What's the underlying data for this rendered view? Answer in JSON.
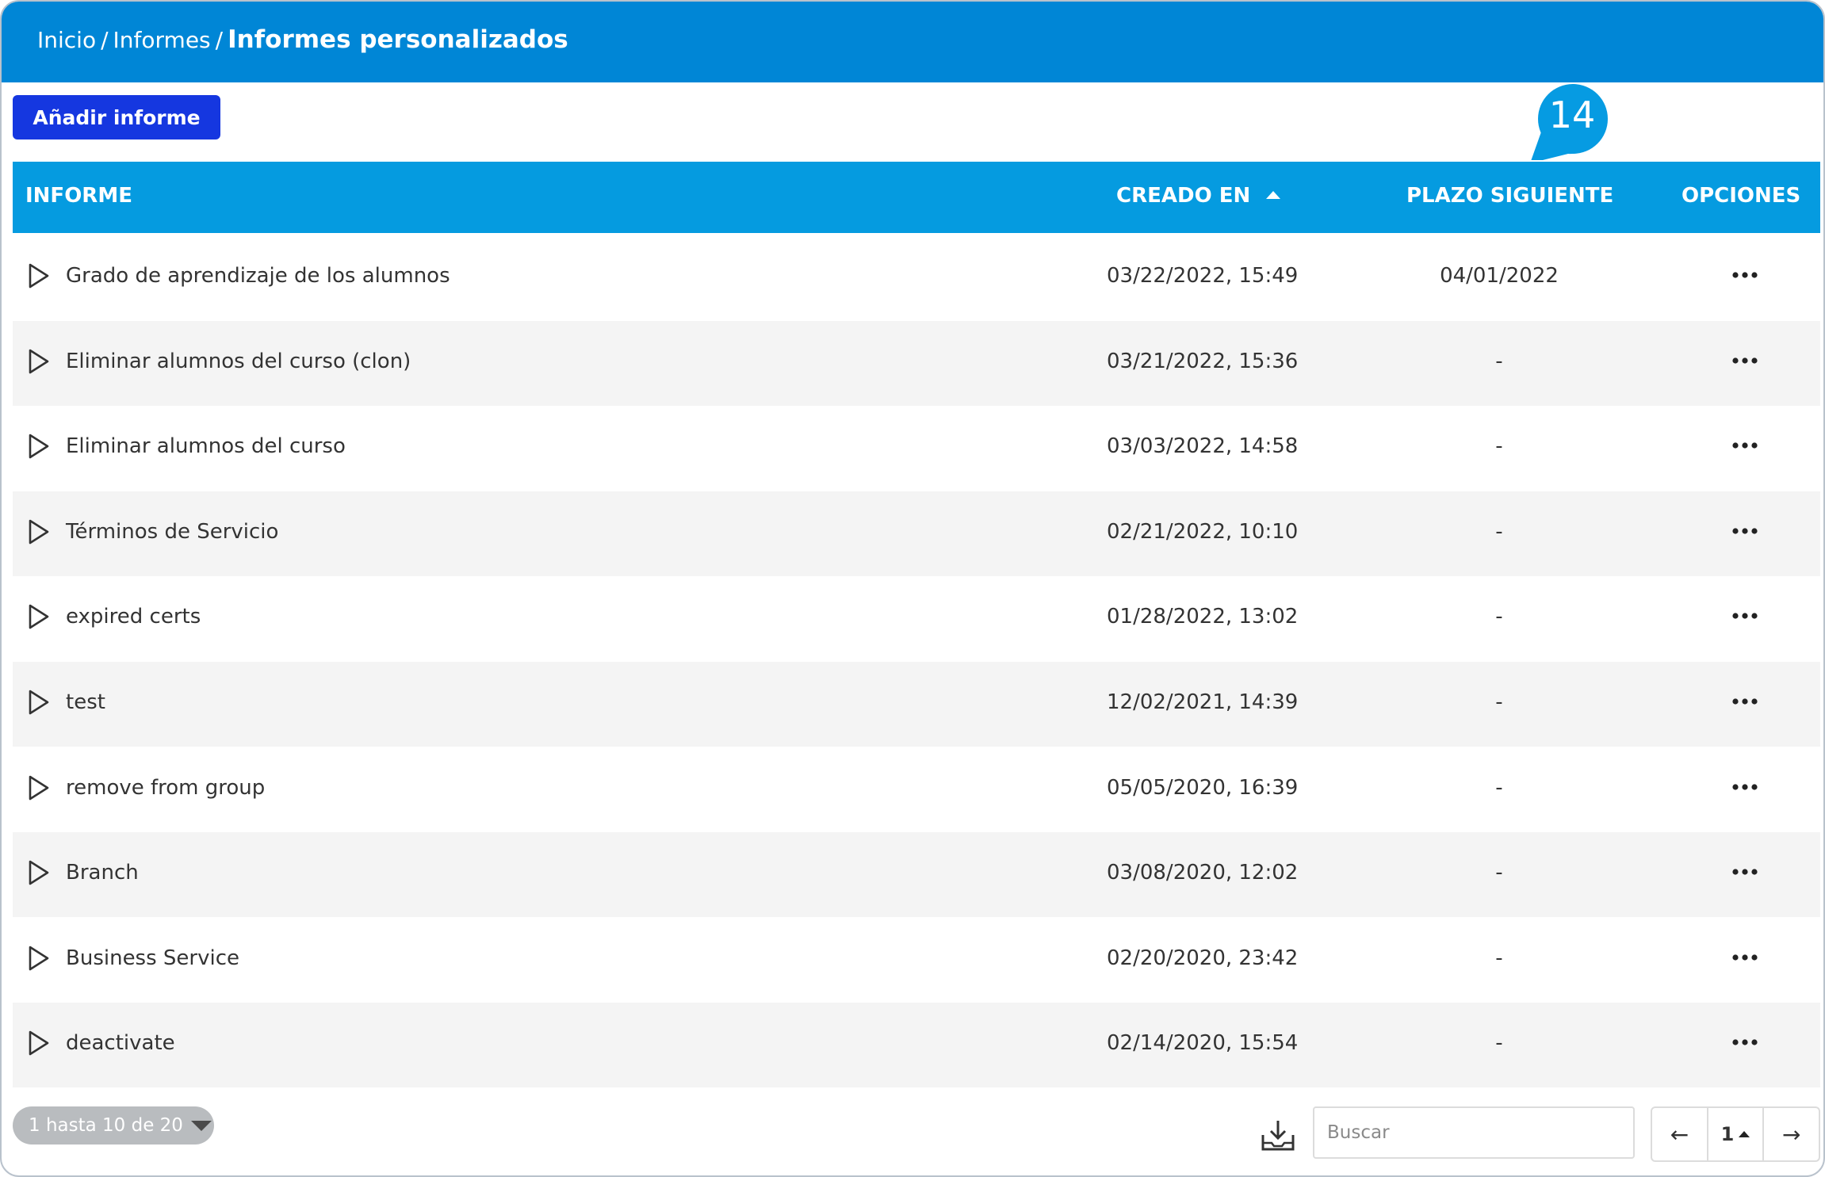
{
  "breadcrumb": {
    "home": "Inicio",
    "separator": "/",
    "section": "Informes",
    "current": "Informes personalizados"
  },
  "actions": {
    "add_report": "Añadir informe"
  },
  "callout": {
    "number": "14"
  },
  "table": {
    "headers": {
      "report": "INFORME",
      "created": "CREADO EN",
      "next_deadline": "PLAZO SIGUIENTE",
      "options": "OPCIONES"
    },
    "sort": {
      "column": "created",
      "direction": "ascending"
    },
    "rows": [
      {
        "name": "Grado de aprendizaje de los alumnos",
        "created": "03/22/2022, 15:49",
        "next": "04/01/2022"
      },
      {
        "name": "Eliminar alumnos del curso (clon)",
        "created": "03/21/2022, 15:36",
        "next": "-"
      },
      {
        "name": "Eliminar alumnos del curso",
        "created": "03/03/2022, 14:58",
        "next": "-"
      },
      {
        "name": "Términos de Servicio",
        "created": "02/21/2022, 10:10",
        "next": "-"
      },
      {
        "name": "expired certs",
        "created": "01/28/2022, 13:02",
        "next": "-"
      },
      {
        "name": "test",
        "created": "12/02/2021, 14:39",
        "next": "-"
      },
      {
        "name": "remove from group",
        "created": "05/05/2020, 16:39",
        "next": "-"
      },
      {
        "name": "Branch",
        "created": "03/08/2020, 12:02",
        "next": "-"
      },
      {
        "name": "Business Service",
        "created": "02/20/2020, 23:42",
        "next": "-"
      },
      {
        "name": "deactivate",
        "created": "02/14/2020, 15:54",
        "next": "-"
      }
    ]
  },
  "footer": {
    "range": "1 hasta 10 de 20",
    "search_placeholder": "Buscar",
    "prev": "←",
    "page": "1",
    "next": "→"
  },
  "icons": {
    "row": "play-icon",
    "options": "more-icon",
    "download": "download-icon",
    "sort": "sort-up-icon"
  },
  "colors": {
    "topbar": "#0086d6",
    "table_header": "#059be0",
    "primary_button": "#1537e0",
    "row_alt": "#f4f4f4"
  }
}
